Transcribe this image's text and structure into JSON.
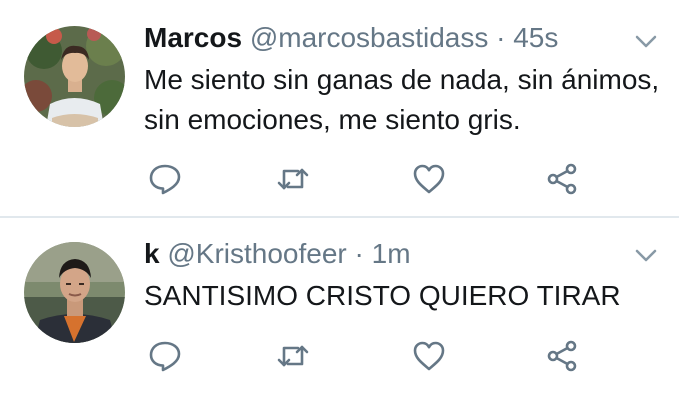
{
  "tweets": [
    {
      "name": "Marcos",
      "handle": "@marcosbastidass",
      "separator": "·",
      "time": "45s",
      "text": "Me siento sin ganas de nada, sin ánimos, sin emociones, me siento gris."
    },
    {
      "name": "k",
      "handle": "@Kristhoofeer",
      "separator": "·",
      "time": "1m",
      "text": "SANTISIMO CRISTO QUIERO TIRAR"
    }
  ],
  "colors": {
    "icon": "#657786",
    "divider": "#e1e8ed",
    "text": "#14171a",
    "secondary": "#657786"
  },
  "icons": [
    "reply-icon",
    "retweet-icon",
    "like-icon",
    "share-icon",
    "chevron-down-icon"
  ]
}
